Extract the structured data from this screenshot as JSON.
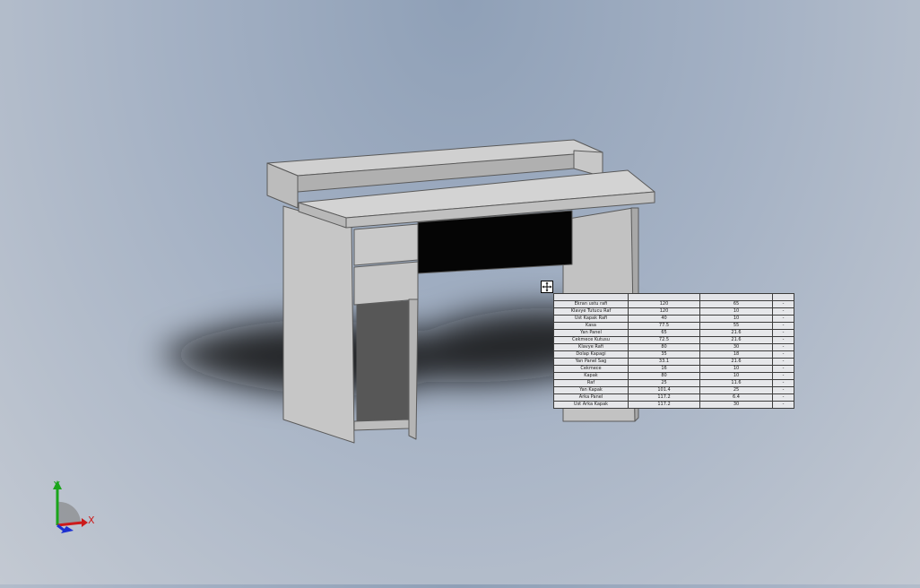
{
  "bom": {
    "headers": [
      "",
      "",
      "",
      ""
    ],
    "rows": [
      [
        "Ekran ustu rafi",
        "120",
        "65",
        "-"
      ],
      [
        "Klavye Tutucu Raf",
        "120",
        "10",
        "-"
      ],
      [
        "Ust Kapak Rafi",
        "40",
        "10",
        "-"
      ],
      [
        "Kasa",
        "77.5",
        "55",
        "-"
      ],
      [
        "Yan Panel",
        "65",
        "21.6",
        "-"
      ],
      [
        "Cekmece Kutusu",
        "72.5",
        "21.6",
        "-"
      ],
      [
        "Klavye Rafi",
        "80",
        "30",
        "-"
      ],
      [
        "Dolap Kapagi",
        "35",
        "18",
        "-"
      ],
      [
        "Yan Panel Sag",
        "33.1",
        "21.6",
        "-"
      ],
      [
        "Cekmece",
        "16",
        "10",
        "-"
      ],
      [
        "Kapak",
        "80",
        "10",
        "-"
      ],
      [
        "Raf",
        "25",
        "11.6",
        "-"
      ],
      [
        "Yan Kapak",
        "101.4",
        "25",
        "-"
      ],
      [
        "Arka Panel",
        "117.2",
        "6.4",
        "-"
      ],
      [
        "Ust Arka Kapak",
        "117.2",
        "30",
        "-"
      ]
    ]
  },
  "triad": {
    "x_label": "X",
    "y_label": "Y"
  },
  "colors": {
    "desk_top": "#d2d2d2",
    "desk_side": "#bdbdbd",
    "desk_edge": "#5a5a5a",
    "triad_x": "#cc1b1b",
    "triad_y": "#1aa51a",
    "triad_z": "#1c2fd1"
  }
}
